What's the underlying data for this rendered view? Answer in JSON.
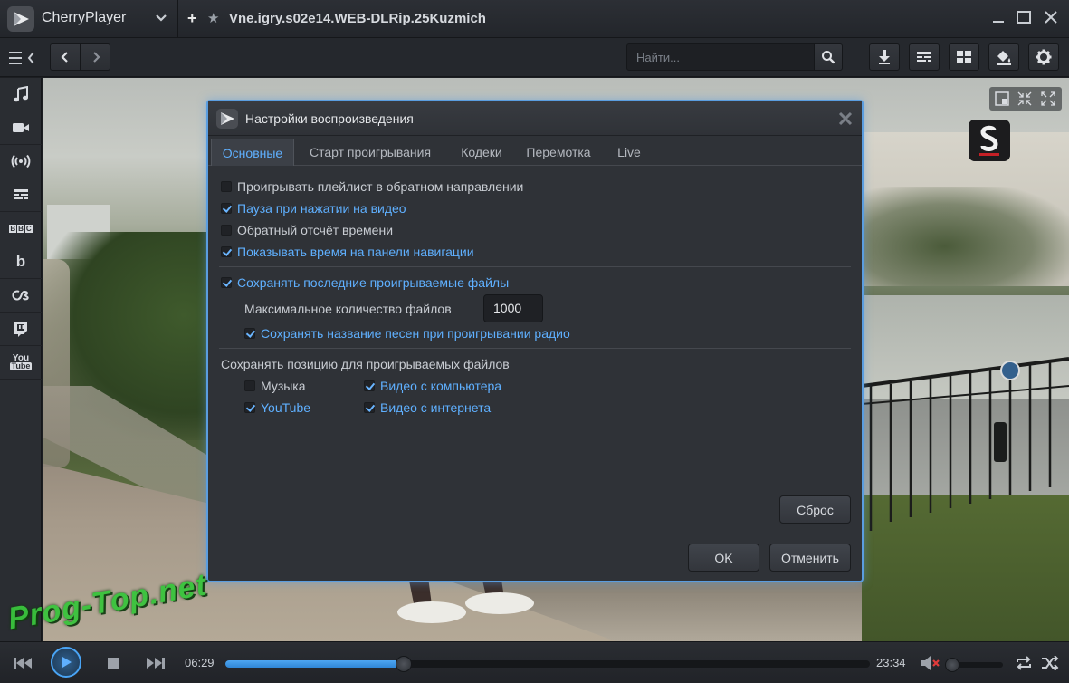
{
  "app": {
    "name": "CherryPlayer",
    "window_title": "Vne.igry.s02e14.WEB-DLRip.25Kuzmich"
  },
  "toolbar": {
    "search_placeholder": "Найти..."
  },
  "sidebar": {
    "items": [
      {
        "icon": "music-note-icon"
      },
      {
        "icon": "video-camera-icon"
      },
      {
        "icon": "radio-broadcast-icon"
      },
      {
        "icon": "tv-icon"
      },
      {
        "icon": "bbc-icon",
        "text": "BBC"
      },
      {
        "icon": "bandcamp-icon",
        "text": "b"
      },
      {
        "icon": "lastfm-icon"
      },
      {
        "icon": "twitch-icon"
      },
      {
        "icon": "youtube-icon",
        "text": "You\nTube"
      }
    ]
  },
  "dialog": {
    "title": "Настройки воспроизведения",
    "tabs": [
      "Основные",
      "Старт проигрывания",
      "Кодеки",
      "Перемотка",
      "Live"
    ],
    "active_tab": 0,
    "options": [
      {
        "label": "Проигрывать плейлист в обратном направлении",
        "checked": false
      },
      {
        "label": "Пауза при нажатии на видео",
        "checked": true
      },
      {
        "label": "Обратный отсчёт времени",
        "checked": false
      },
      {
        "label": "Показывать время на панели навигации",
        "checked": true
      },
      {
        "label": "Сохранять последние проигрываемые файлы",
        "checked": true
      }
    ],
    "max_files_label": "Максимальное количество файлов",
    "max_files_value": "1000",
    "save_song_names": {
      "label": "Сохранять название песен при проигрывании радио",
      "checked": true
    },
    "position_heading": "Сохранять позицию для проигрываемых файлов",
    "position_options": [
      {
        "label": "Музыка",
        "checked": false
      },
      {
        "label": "Видео с компьютера",
        "checked": true
      },
      {
        "label": "YouTube",
        "checked": true
      },
      {
        "label": "Видео с интернета",
        "checked": true
      }
    ],
    "reset_label": "Сброс",
    "ok_label": "OK",
    "cancel_label": "Отменить"
  },
  "player": {
    "current_time": "06:29",
    "total_time": "23:34",
    "progress": 0.277,
    "volume": 0.0,
    "muted": true
  },
  "watermark": "Prog-Top.net",
  "colors": {
    "accent": "#5fb0ff",
    "dialog_border": "#5a9de0",
    "progress": "#3a95e6",
    "mute_x": "#e23b3b",
    "watermark": "#39c43c"
  }
}
